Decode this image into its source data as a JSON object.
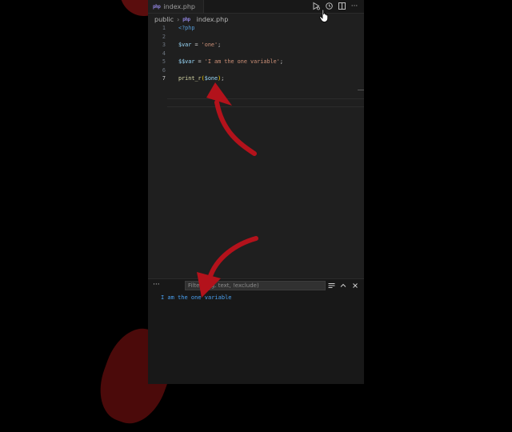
{
  "editor": {
    "tab": {
      "label": "index.php",
      "icon": "php-file-icon"
    },
    "breadcrumb": {
      "folder": "public",
      "file": "index.php"
    },
    "actions": [
      "run-debug-icon",
      "timeline-icon",
      "split-editor-icon",
      "more-actions-icon"
    ],
    "lines": [
      {
        "number": "1",
        "tokens": [
          {
            "t": "<?php",
            "c": "tag"
          }
        ]
      },
      {
        "number": "2",
        "tokens": []
      },
      {
        "number": "3",
        "tokens": [
          {
            "t": "$var",
            "c": "var"
          },
          {
            "t": " = ",
            "c": "op"
          },
          {
            "t": "'one'",
            "c": "str"
          },
          {
            "t": ";",
            "c": "op"
          }
        ]
      },
      {
        "number": "4",
        "tokens": []
      },
      {
        "number": "5",
        "tokens": [
          {
            "t": "$$var",
            "c": "var"
          },
          {
            "t": " = ",
            "c": "op"
          },
          {
            "t": "'I am the one variable'",
            "c": "str"
          },
          {
            "t": ";",
            "c": "op"
          }
        ]
      },
      {
        "number": "6",
        "tokens": []
      },
      {
        "number": "7",
        "tokens": [
          {
            "t": "print_r",
            "c": "fn"
          },
          {
            "t": "(",
            "c": "paren"
          },
          {
            "t": "$one",
            "c": "var"
          },
          {
            "t": ")",
            "c": "paren"
          },
          {
            "t": ";",
            "c": "op"
          }
        ]
      }
    ],
    "active_line": "7"
  },
  "panel": {
    "filter_placeholder": "Filter (e.g. text, !exclude)",
    "output": "I am the one variable",
    "actions": [
      "list-filter-icon",
      "chevron-up-icon",
      "close-icon"
    ]
  },
  "colors": {
    "editor_bg": "#1f1f1f",
    "output_text": "#4aa0f0",
    "annotation_arrow": "#b3121b"
  }
}
